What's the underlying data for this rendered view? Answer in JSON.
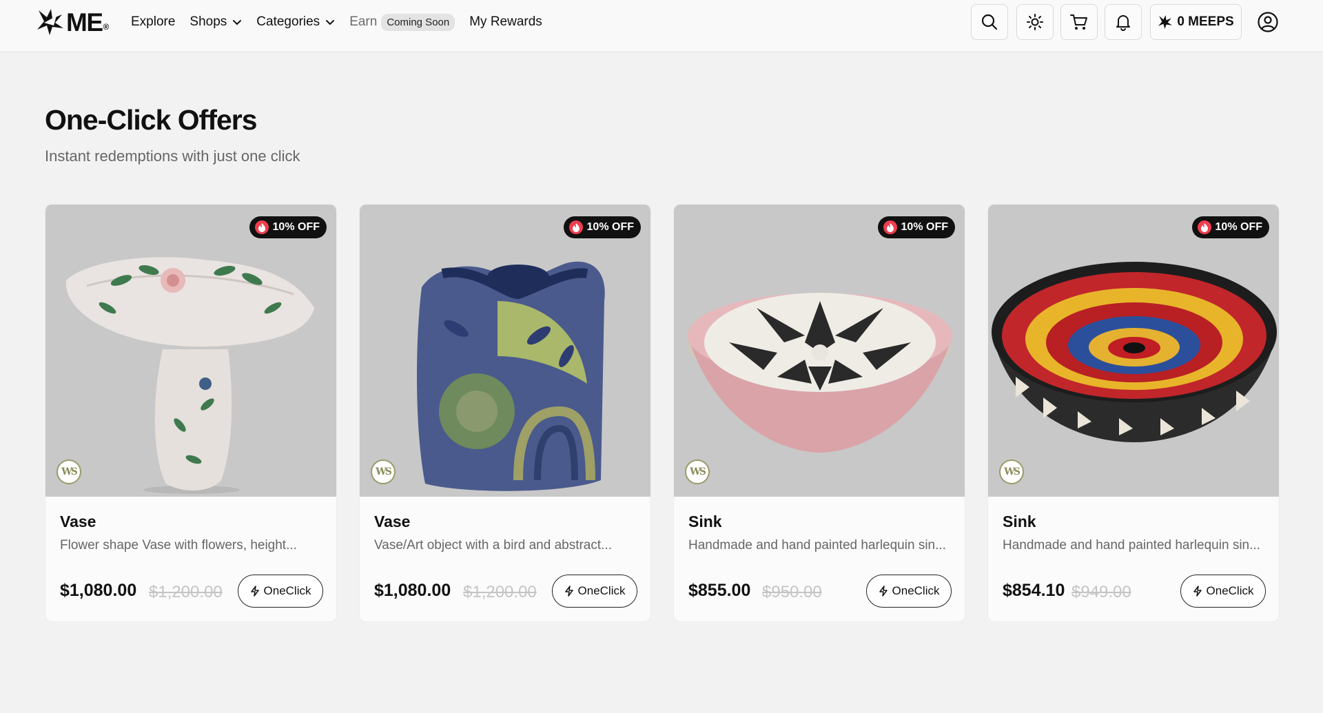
{
  "brand": {
    "name": "ME",
    "reg": "®"
  },
  "nav": {
    "explore": "Explore",
    "shops": "Shops",
    "categories": "Categories",
    "earn": "Earn",
    "coming_soon": "Coming Soon",
    "my_rewards": "My Rewards"
  },
  "header": {
    "meeps": "0 MEEPS"
  },
  "page": {
    "title": "One-Click Offers",
    "subtitle": "Instant redemptions with just one click"
  },
  "offers": [
    {
      "badge": "10% OFF",
      "name": "Vase",
      "description": "Flower shape Vase with flowers, height...",
      "price": "$1,080.00",
      "old_price": "$1,200.00",
      "cta": "OneClick",
      "shop_logo": "WS"
    },
    {
      "badge": "10% OFF",
      "name": "Vase",
      "description": "Vase/Art object with a bird and abstract...",
      "price": "$1,080.00",
      "old_price": "$1,200.00",
      "cta": "OneClick",
      "shop_logo": "WS"
    },
    {
      "badge": "10% OFF",
      "name": "Sink",
      "description": "Handmade and hand painted harlequin sin...",
      "price": "$855.00",
      "old_price": "$950.00",
      "cta": "OneClick",
      "shop_logo": "WS"
    },
    {
      "badge": "10% OFF",
      "name": "Sink",
      "description": "Handmade and hand painted harlequin sin...",
      "price": "$854.10",
      "old_price": "$949.00",
      "cta": "OneClick",
      "shop_logo": "WS"
    }
  ],
  "icons": {
    "search": "search-icon",
    "theme": "sun-icon",
    "cart": "cart-icon",
    "notifications": "bell-icon",
    "account": "user-circle-icon",
    "meeps": "meeps-logo-icon",
    "fire": "fire-icon",
    "bolt": "lightning-icon",
    "chevron": "chevron-down-icon"
  },
  "colors": {
    "badge_bg": "#111111",
    "fire": "#ef3e4f",
    "page_bg": "#f2f2f2",
    "old_price": "#c4c4c4"
  }
}
